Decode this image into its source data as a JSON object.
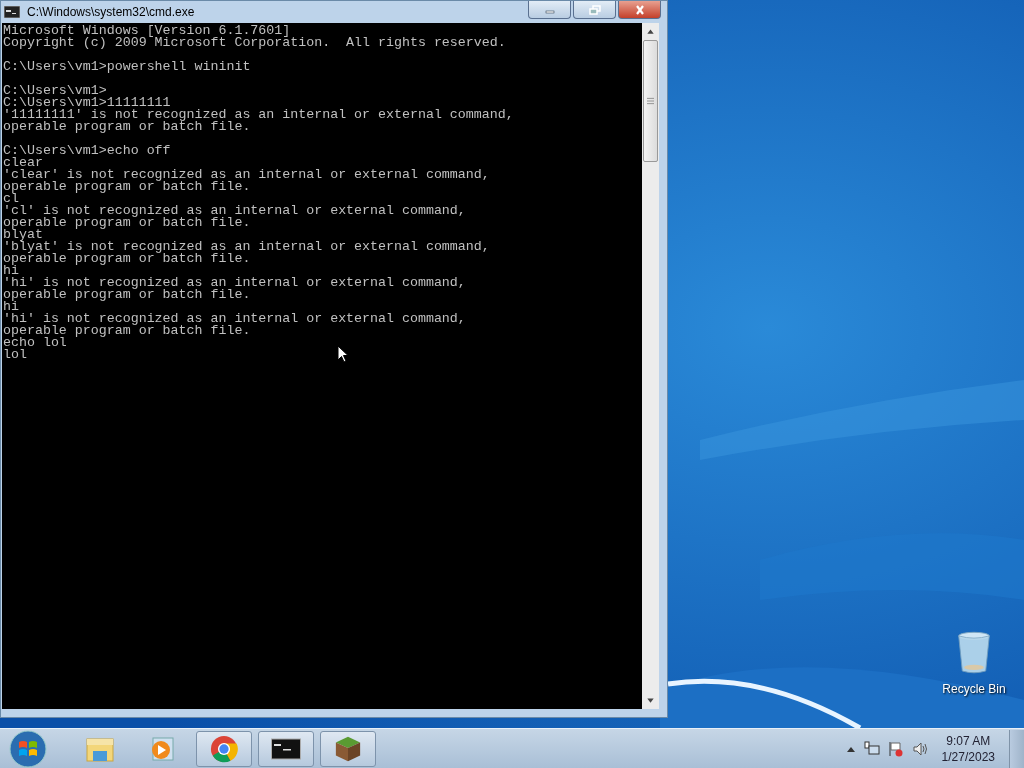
{
  "window": {
    "title": "C:\\Windows\\system32\\cmd.exe",
    "console_blocks": [
      [
        "Microsoft Windows [Version 6.1.7601]",
        "Copyright (c) 2009 Microsoft Corporation.  All rights reserved."
      ],
      [
        "C:\\Users\\vm1>powershell wininit"
      ],
      [
        "C:\\Users\\vm1>",
        "C:\\Users\\vm1>11111111",
        "'11111111' is not recognized as an internal or external command,",
        "operable program or batch file."
      ],
      [
        "C:\\Users\\vm1>echo off",
        "clear",
        "'clear' is not recognized as an internal or external command,",
        "operable program or batch file.",
        "cl",
        "'cl' is not recognized as an internal or external command,",
        "operable program or batch file.",
        "blyat",
        "'blyat' is not recognized as an internal or external command,",
        "operable program or batch file.",
        "hi",
        "'hi' is not recognized as an internal or external command,",
        "operable program or batch file.",
        "hi",
        "'hi' is not recognized as an internal or external command,",
        "operable program or batch file.",
        "echo lol",
        "lol"
      ]
    ]
  },
  "desktop_icons": [
    {
      "label": "Recycle Bin"
    }
  ],
  "taskbar": {
    "items": [
      {
        "kind": "explorer",
        "running": false
      },
      {
        "kind": "media",
        "running": false
      },
      {
        "kind": "chrome",
        "running": true
      },
      {
        "kind": "console",
        "running": true
      },
      {
        "kind": "block",
        "running": true
      }
    ],
    "clock": {
      "time": "9:07 AM",
      "date": "1/27/2023"
    }
  }
}
